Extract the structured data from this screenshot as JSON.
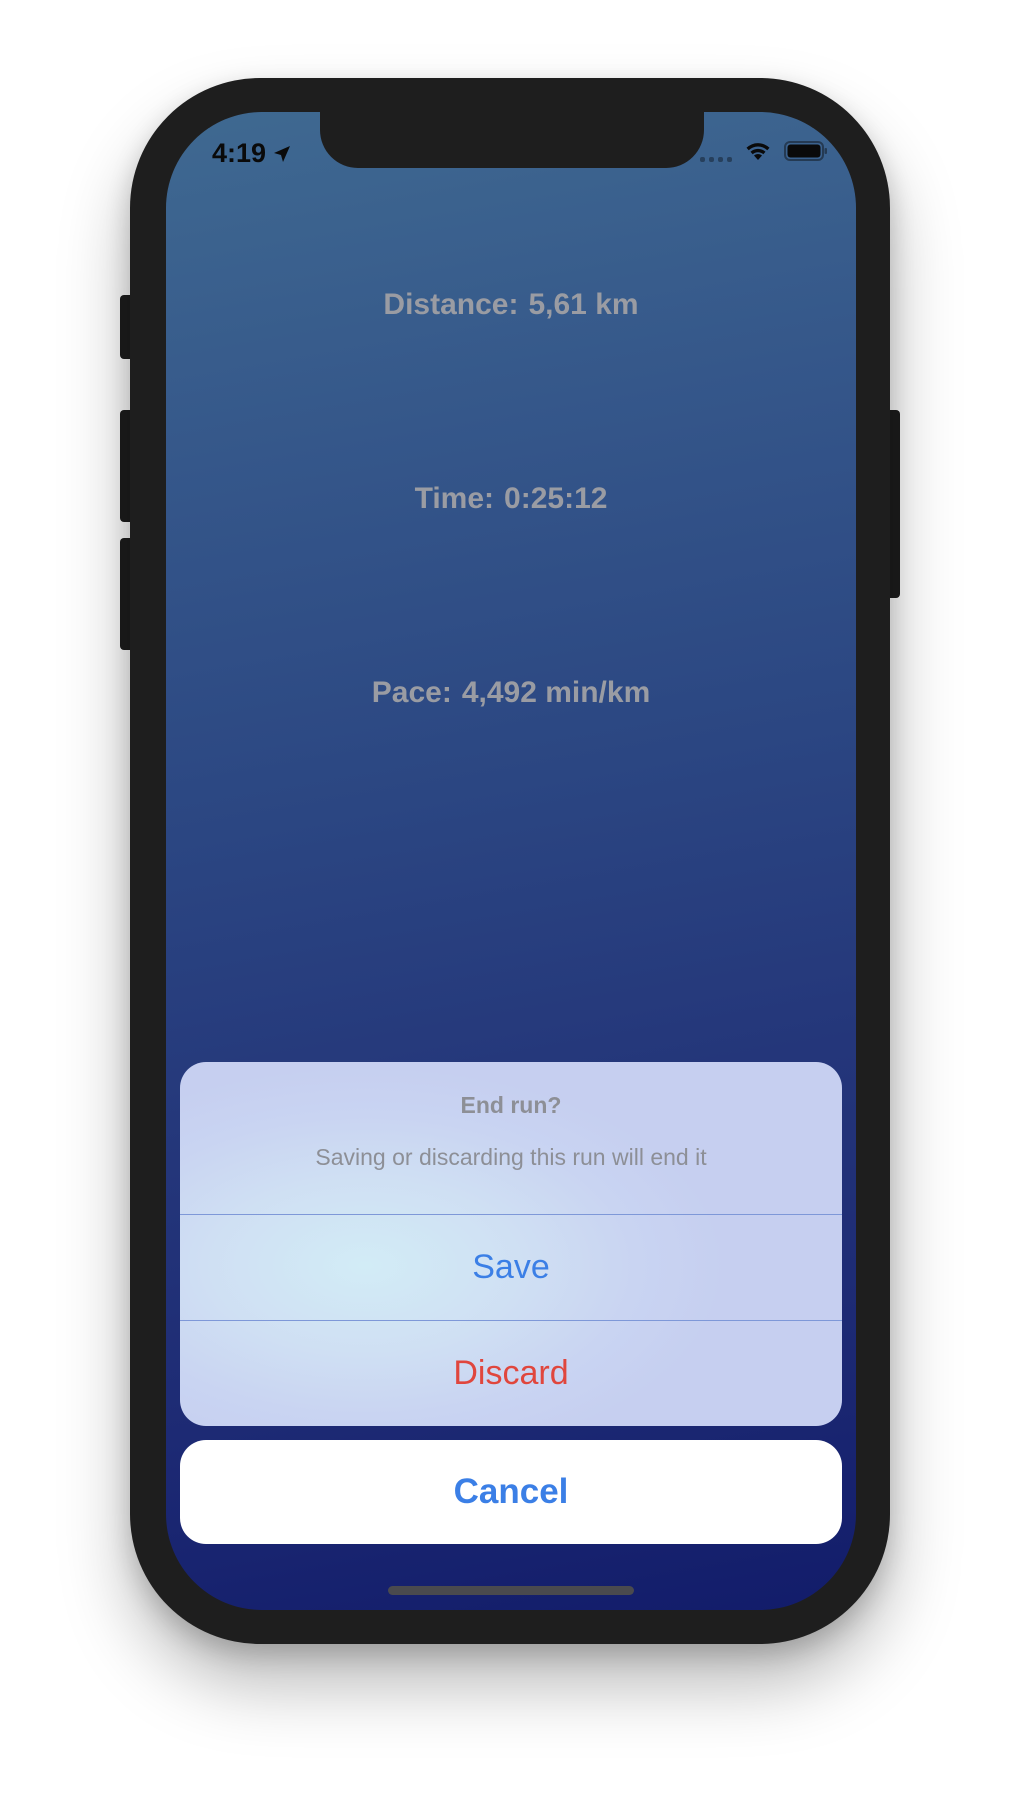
{
  "status_bar": {
    "time": "4:19",
    "location_icon": "location-arrow-icon",
    "wifi_icon": "wifi-icon",
    "battery_icon": "battery-icon"
  },
  "stats": {
    "distance": {
      "label": "Distance:",
      "value": "5,61 km"
    },
    "time": {
      "label": "Time:",
      "value": "0:25:12"
    },
    "pace": {
      "label": "Pace:",
      "value": "4,492 min/km"
    }
  },
  "action_sheet": {
    "title": "End run?",
    "message": "Saving or discarding this run will end it",
    "save_label": "Save",
    "discard_label": "Discard",
    "cancel_label": "Cancel"
  },
  "colors": {
    "action_blue": "#3b7fe6",
    "destructive_red": "#e0463d",
    "stat_text": "#9a9ca3",
    "background_top": "#3f6991",
    "background_bottom": "#121c6a"
  }
}
